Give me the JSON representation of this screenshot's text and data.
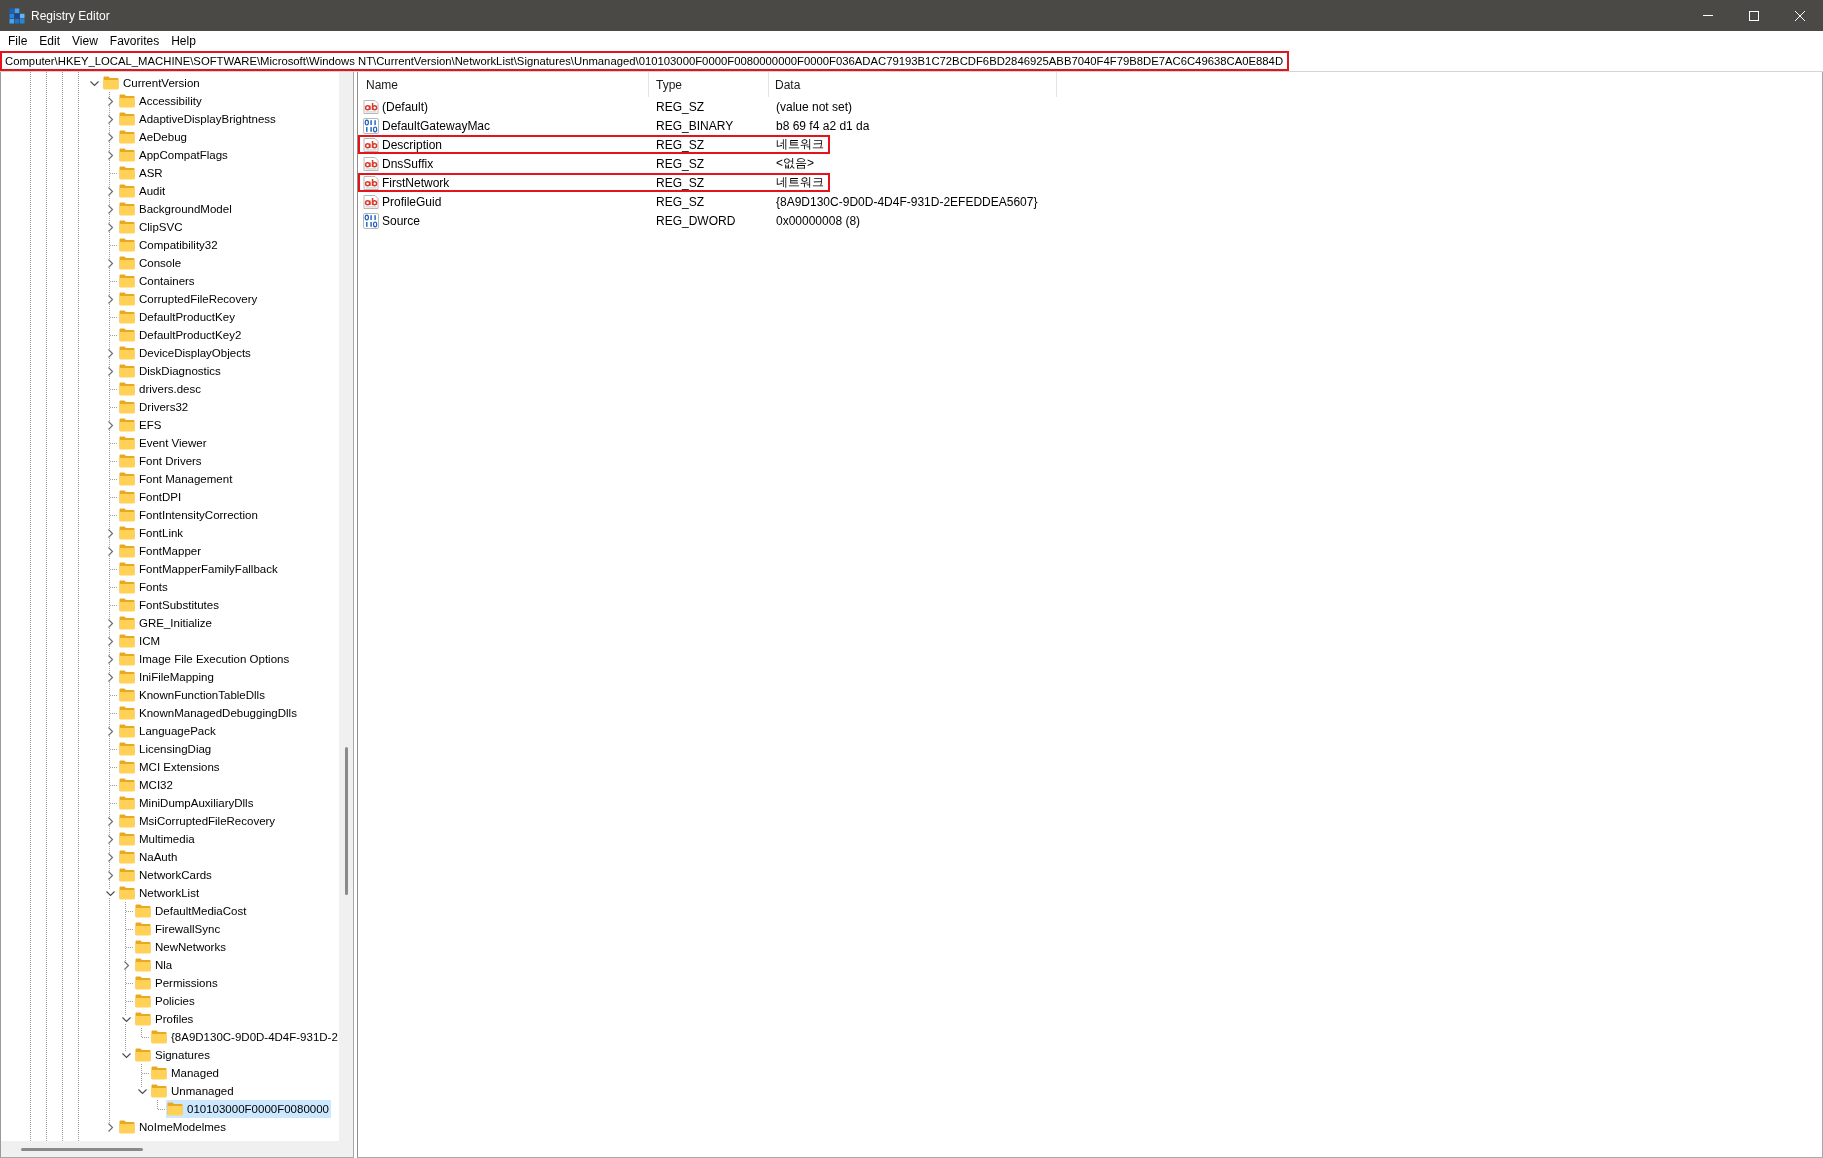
{
  "window": {
    "title": "Registry Editor"
  },
  "menu": [
    "File",
    "Edit",
    "View",
    "Favorites",
    "Help"
  ],
  "address_bar": {
    "path": "Computer\\HKEY_LOCAL_MACHINE\\SOFTWARE\\Microsoft\\Windows NT\\CurrentVersion\\NetworkList\\Signatures\\Unmanaged\\010103000F0000F0080000000F0000F036ADAC79193B1C72BCDF6BD2846925ABB7040F4F79B8DE7AC6C49638CA0E884D",
    "highlighted": true
  },
  "tree": [
    {
      "label": "CurrentVersion",
      "expandable": true,
      "expanded": true,
      "selected": false,
      "children": [
        {
          "label": "Accessibility",
          "expandable": true,
          "expanded": false,
          "selected": false
        },
        {
          "label": "AdaptiveDisplayBrightness",
          "expandable": true,
          "expanded": false,
          "selected": false
        },
        {
          "label": "AeDebug",
          "expandable": true,
          "expanded": false,
          "selected": false
        },
        {
          "label": "AppCompatFlags",
          "expandable": true,
          "expanded": false,
          "selected": false
        },
        {
          "label": "ASR",
          "expandable": false,
          "expanded": false,
          "selected": false
        },
        {
          "label": "Audit",
          "expandable": true,
          "expanded": false,
          "selected": false
        },
        {
          "label": "BackgroundModel",
          "expandable": true,
          "expanded": false,
          "selected": false
        },
        {
          "label": "ClipSVC",
          "expandable": true,
          "expanded": false,
          "selected": false
        },
        {
          "label": "Compatibility32",
          "expandable": false,
          "expanded": false,
          "selected": false
        },
        {
          "label": "Console",
          "expandable": true,
          "expanded": false,
          "selected": false
        },
        {
          "label": "Containers",
          "expandable": false,
          "expanded": false,
          "selected": false
        },
        {
          "label": "CorruptedFileRecovery",
          "expandable": true,
          "expanded": false,
          "selected": false
        },
        {
          "label": "DefaultProductKey",
          "expandable": false,
          "expanded": false,
          "selected": false
        },
        {
          "label": "DefaultProductKey2",
          "expandable": false,
          "expanded": false,
          "selected": false
        },
        {
          "label": "DeviceDisplayObjects",
          "expandable": true,
          "expanded": false,
          "selected": false
        },
        {
          "label": "DiskDiagnostics",
          "expandable": true,
          "expanded": false,
          "selected": false
        },
        {
          "label": "drivers.desc",
          "expandable": false,
          "expanded": false,
          "selected": false
        },
        {
          "label": "Drivers32",
          "expandable": false,
          "expanded": false,
          "selected": false
        },
        {
          "label": "EFS",
          "expandable": true,
          "expanded": false,
          "selected": false
        },
        {
          "label": "Event Viewer",
          "expandable": false,
          "expanded": false,
          "selected": false
        },
        {
          "label": "Font Drivers",
          "expandable": false,
          "expanded": false,
          "selected": false
        },
        {
          "label": "Font Management",
          "expandable": false,
          "expanded": false,
          "selected": false
        },
        {
          "label": "FontDPI",
          "expandable": false,
          "expanded": false,
          "selected": false
        },
        {
          "label": "FontIntensityCorrection",
          "expandable": false,
          "expanded": false,
          "selected": false
        },
        {
          "label": "FontLink",
          "expandable": true,
          "expanded": false,
          "selected": false
        },
        {
          "label": "FontMapper",
          "expandable": true,
          "expanded": false,
          "selected": false
        },
        {
          "label": "FontMapperFamilyFallback",
          "expandable": false,
          "expanded": false,
          "selected": false
        },
        {
          "label": "Fonts",
          "expandable": false,
          "expanded": false,
          "selected": false
        },
        {
          "label": "FontSubstitutes",
          "expandable": false,
          "expanded": false,
          "selected": false
        },
        {
          "label": "GRE_Initialize",
          "expandable": true,
          "expanded": false,
          "selected": false
        },
        {
          "label": "ICM",
          "expandable": true,
          "expanded": false,
          "selected": false
        },
        {
          "label": "Image File Execution Options",
          "expandable": true,
          "expanded": false,
          "selected": false
        },
        {
          "label": "IniFileMapping",
          "expandable": true,
          "expanded": false,
          "selected": false
        },
        {
          "label": "KnownFunctionTableDlls",
          "expandable": false,
          "expanded": false,
          "selected": false
        },
        {
          "label": "KnownManagedDebuggingDlls",
          "expandable": false,
          "expanded": false,
          "selected": false
        },
        {
          "label": "LanguagePack",
          "expandable": true,
          "expanded": false,
          "selected": false
        },
        {
          "label": "LicensingDiag",
          "expandable": false,
          "expanded": false,
          "selected": false
        },
        {
          "label": "MCI Extensions",
          "expandable": false,
          "expanded": false,
          "selected": false
        },
        {
          "label": "MCI32",
          "expandable": false,
          "expanded": false,
          "selected": false
        },
        {
          "label": "MiniDumpAuxiliaryDlls",
          "expandable": false,
          "expanded": false,
          "selected": false
        },
        {
          "label": "MsiCorruptedFileRecovery",
          "expandable": true,
          "expanded": false,
          "selected": false
        },
        {
          "label": "Multimedia",
          "expandable": true,
          "expanded": false,
          "selected": false
        },
        {
          "label": "NaAuth",
          "expandable": true,
          "expanded": false,
          "selected": false
        },
        {
          "label": "NetworkCards",
          "expandable": true,
          "expanded": false,
          "selected": false
        },
        {
          "label": "NetworkList",
          "expandable": true,
          "expanded": true,
          "selected": false,
          "children": [
            {
              "label": "DefaultMediaCost",
              "expandable": false,
              "expanded": false,
              "selected": false
            },
            {
              "label": "FirewallSync",
              "expandable": false,
              "expanded": false,
              "selected": false
            },
            {
              "label": "NewNetworks",
              "expandable": false,
              "expanded": false,
              "selected": false
            },
            {
              "label": "Nla",
              "expandable": true,
              "expanded": false,
              "selected": false
            },
            {
              "label": "Permissions",
              "expandable": false,
              "expanded": false,
              "selected": false
            },
            {
              "label": "Policies",
              "expandable": false,
              "expanded": false,
              "selected": false
            },
            {
              "label": "Profiles",
              "expandable": true,
              "expanded": true,
              "selected": false,
              "children": [
                {
                  "label": "{8A9D130C-9D0D-4D4F-931D-2",
                  "expandable": false,
                  "expanded": false,
                  "selected": false
                }
              ]
            },
            {
              "label": "Signatures",
              "expandable": true,
              "expanded": true,
              "selected": false,
              "children": [
                {
                  "label": "Managed",
                  "expandable": false,
                  "expanded": false,
                  "selected": false
                },
                {
                  "label": "Unmanaged",
                  "expandable": true,
                  "expanded": true,
                  "selected": false,
                  "children": [
                    {
                      "label": "010103000F0000F0080000",
                      "expandable": false,
                      "expanded": false,
                      "selected": true
                    }
                  ]
                }
              ]
            }
          ]
        },
        {
          "label": "NoImeModelmes",
          "expandable": true,
          "expanded": false,
          "selected": false
        }
      ]
    }
  ],
  "values": {
    "columns": [
      "Name",
      "Type",
      "Data"
    ],
    "rows": [
      {
        "kind": "string",
        "name": "(Default)",
        "type": "REG_SZ",
        "data": "(value not set)",
        "highlighted": false
      },
      {
        "kind": "binary",
        "name": "DefaultGatewayMac",
        "type": "REG_BINARY",
        "data": "b8 69 f4 a2 d1 da",
        "highlighted": false
      },
      {
        "kind": "string",
        "name": "Description",
        "type": "REG_SZ",
        "data": "네트워크",
        "highlighted": true
      },
      {
        "kind": "string",
        "name": "DnsSuffix",
        "type": "REG_SZ",
        "data": "<없음>",
        "highlighted": false
      },
      {
        "kind": "string",
        "name": "FirstNetwork",
        "type": "REG_SZ",
        "data": "네트워크",
        "highlighted": true
      },
      {
        "kind": "string",
        "name": "ProfileGuid",
        "type": "REG_SZ",
        "data": "{8A9D130C-9D0D-4D4F-931D-2EFEDDEA5607}",
        "highlighted": false
      },
      {
        "kind": "binary",
        "name": "Source",
        "type": "REG_DWORD",
        "data": "0x00000008 (8)",
        "highlighted": false
      }
    ]
  }
}
